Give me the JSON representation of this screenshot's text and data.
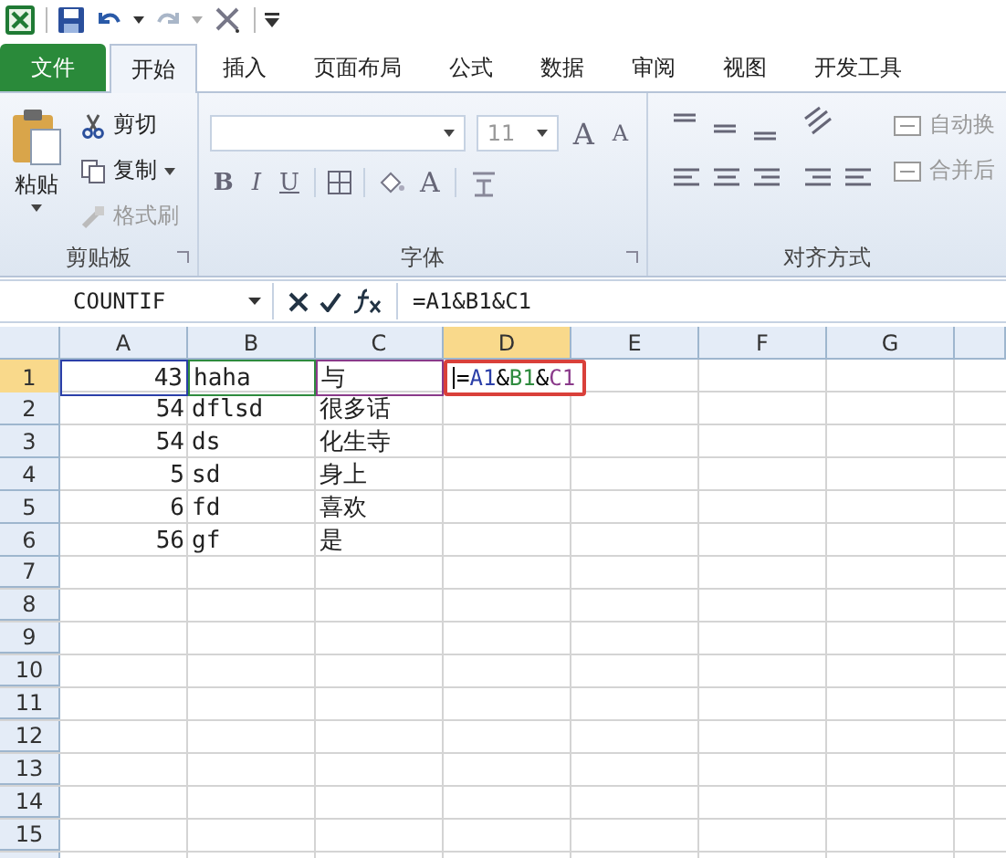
{
  "quick_access": {
    "undo_menu": true,
    "redo_menu": true
  },
  "tabs": [
    {
      "label": "文件",
      "kind": "file",
      "selected": false
    },
    {
      "label": "开始",
      "kind": "tab",
      "selected": true
    },
    {
      "label": "插入",
      "kind": "tab",
      "selected": false
    },
    {
      "label": "页面布局",
      "kind": "tab",
      "selected": false
    },
    {
      "label": "公式",
      "kind": "tab",
      "selected": false
    },
    {
      "label": "数据",
      "kind": "tab",
      "selected": false
    },
    {
      "label": "审阅",
      "kind": "tab",
      "selected": false
    },
    {
      "label": "视图",
      "kind": "tab",
      "selected": false
    },
    {
      "label": "开发工具",
      "kind": "tab",
      "selected": false
    }
  ],
  "ribbon": {
    "clipboard": {
      "label": "剪贴板",
      "paste": "粘贴",
      "items": [
        {
          "label": "剪切",
          "kind": "cut",
          "disabled": false
        },
        {
          "label": "复制",
          "kind": "copy",
          "disabled": false
        },
        {
          "label": "格式刷",
          "kind": "brush",
          "disabled": true
        }
      ]
    },
    "font": {
      "label": "字体",
      "size": "11",
      "size_disabled": true,
      "grow": "A",
      "shrink": "A",
      "styles": [
        "B",
        "I",
        "U"
      ],
      "font_color": "A"
    },
    "alignment": {
      "label": "对齐方式",
      "items": [
        {
          "label": "自动换",
          "disabled": true
        },
        {
          "label": "合并后",
          "disabled": true
        }
      ]
    }
  },
  "formula_bar": {
    "name_box": "COUNTIF",
    "formula": "=A1&B1&C1"
  },
  "sheet": {
    "columns": [
      {
        "label": "A",
        "selected": false
      },
      {
        "label": "B",
        "selected": false
      },
      {
        "label": "C",
        "selected": false
      },
      {
        "label": "D",
        "selected": true
      },
      {
        "label": "E",
        "selected": false
      },
      {
        "label": "F",
        "selected": false
      },
      {
        "label": "G",
        "selected": false
      }
    ],
    "rows": [
      {
        "header": "1",
        "selected": true,
        "cells": [
          {
            "text": "43",
            "kind": "number",
            "color": "#2b3fa8"
          },
          {
            "text": "haha",
            "kind": "text",
            "color": "#2e8b3e"
          },
          {
            "text": "与",
            "kind": "text",
            "color": "#8a3a8a"
          }
        ],
        "editing": {
          "parts": [
            {
              "text": "=",
              "color": "#000000"
            },
            {
              "text": "A1",
              "color": "#2b3fa8"
            },
            {
              "text": "&",
              "color": "#000000"
            },
            {
              "text": "B1",
              "color": "#2e8b3e"
            },
            {
              "text": "&",
              "color": "#000000"
            },
            {
              "text": "C1",
              "color": "#8a3a8a"
            }
          ]
        }
      },
      {
        "header": "2",
        "selected": false,
        "cells": [
          {
            "text": "54",
            "kind": "number"
          },
          {
            "text": "dflsd",
            "kind": "text"
          },
          {
            "text": "很多话",
            "kind": "text"
          }
        ]
      },
      {
        "header": "3",
        "selected": false,
        "cells": [
          {
            "text": "54",
            "kind": "number"
          },
          {
            "text": "ds",
            "kind": "text"
          },
          {
            "text": "化生寺",
            "kind": "text"
          }
        ]
      },
      {
        "header": "4",
        "selected": false,
        "cells": [
          {
            "text": "5",
            "kind": "number"
          },
          {
            "text": "sd",
            "kind": "text"
          },
          {
            "text": "身上",
            "kind": "text"
          }
        ]
      },
      {
        "header": "5",
        "selected": false,
        "cells": [
          {
            "text": "6",
            "kind": "number"
          },
          {
            "text": "fd",
            "kind": "text"
          },
          {
            "text": "喜欢",
            "kind": "text"
          }
        ]
      },
      {
        "header": "6",
        "selected": false,
        "cells": [
          {
            "text": "56",
            "kind": "number"
          },
          {
            "text": "gf",
            "kind": "text"
          },
          {
            "text": "是",
            "kind": "text"
          }
        ]
      },
      {
        "header": "7",
        "selected": false
      },
      {
        "header": "8",
        "selected": false
      },
      {
        "header": "9",
        "selected": false
      },
      {
        "header": "10",
        "selected": false
      },
      {
        "header": "11",
        "selected": false
      },
      {
        "header": "12",
        "selected": false
      },
      {
        "header": "13",
        "selected": false
      },
      {
        "header": "14",
        "selected": false
      },
      {
        "header": "15",
        "selected": false
      }
    ]
  }
}
